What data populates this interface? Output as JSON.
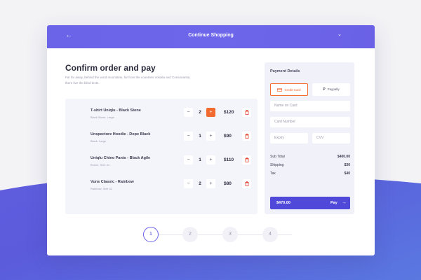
{
  "header": {
    "title": "Continue Shopping",
    "back_icon": "arrow-left-icon",
    "menu_icon": "chevron-down-icon"
  },
  "page": {
    "title": "Confirm order and pay",
    "description": "Far far away, behind the word mountains, far from the countries Vokalia and Consonantia, there live the blind texts."
  },
  "items": [
    {
      "name": "T-shirt Uniqlu - Black Stone",
      "meta": "Black Stone, Large",
      "qty": "2",
      "price": "$120",
      "plus_active": true
    },
    {
      "name": "Unspectore Hoodie - Dope Black",
      "meta": "Black, Large",
      "qty": "1",
      "price": "$90",
      "plus_active": false
    },
    {
      "name": "Uniqlu Chino Pants - Black Agile",
      "meta": "Brown, Size 34",
      "qty": "1",
      "price": "$110",
      "plus_active": false
    },
    {
      "name": "Vuns Classic - Rainbow",
      "meta": "Rainbow, Size 42",
      "qty": "2",
      "price": "$80",
      "plus_active": false
    }
  ],
  "payment": {
    "title": "Payment Details",
    "methods": [
      {
        "label": "Credit Card",
        "icon": "credit-card-icon",
        "selected": true
      },
      {
        "label": "Paypally",
        "icon": "paypal-icon",
        "selected": false
      }
    ],
    "fields": {
      "name": "Name on Card",
      "number": "Card Number",
      "expiry": "Expiry",
      "cvv": "CVV"
    },
    "summary": [
      {
        "label": "Sub Total",
        "value": "$400.00"
      },
      {
        "label": "Shipping",
        "value": "$30"
      },
      {
        "label": "Tax",
        "value": "$40"
      }
    ],
    "pay_button": {
      "amount": "$470.00",
      "label": "Pay"
    }
  },
  "steps": [
    "1",
    "2",
    "3",
    "4"
  ],
  "current_step": "1",
  "colors": {
    "primary": "#6b63e8",
    "accent": "#f26a2e",
    "pay_button": "#5048d8"
  }
}
